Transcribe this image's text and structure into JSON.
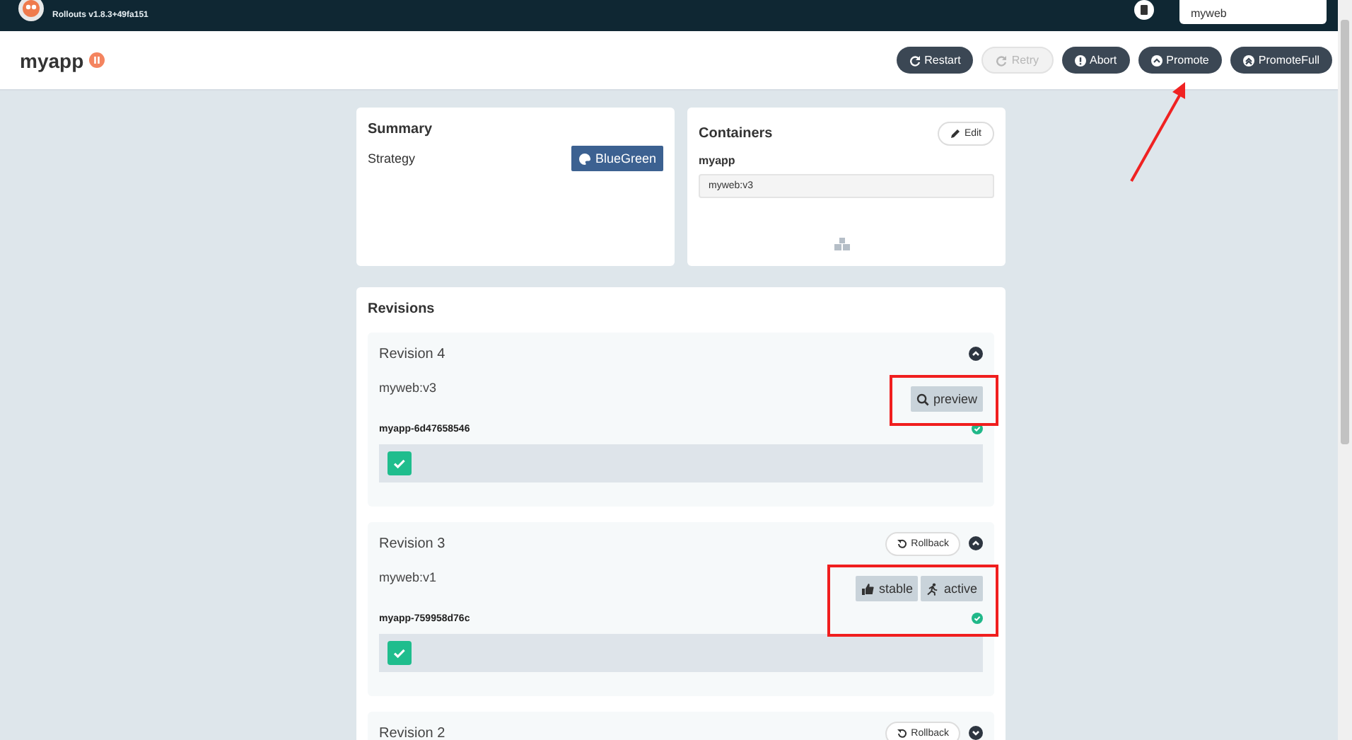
{
  "header": {
    "version": "Rollouts v1.8.3+49fa151",
    "search": {
      "value": "myweb"
    }
  },
  "title": {
    "name": "myapp",
    "paused": true
  },
  "actions": [
    {
      "label": "Restart",
      "kind": "restart",
      "disabled": false
    },
    {
      "label": "Retry",
      "kind": "retry",
      "disabled": true
    },
    {
      "label": "Abort",
      "kind": "abort",
      "disabled": false
    },
    {
      "label": "Promote",
      "kind": "promote",
      "disabled": false
    },
    {
      "label": "PromoteFull",
      "kind": "promotefull",
      "disabled": false
    }
  ],
  "summary": {
    "title": "Summary",
    "label": "Strategy",
    "strategy": "BlueGreen"
  },
  "containers": {
    "title": "Containers",
    "edit": "Edit",
    "name": "myapp",
    "image": "myweb:v3"
  },
  "revisions": {
    "title": "Revisions",
    "items": [
      {
        "title": "Revision 4",
        "expanded": true,
        "image": "myweb:v3",
        "badges": [
          {
            "kind": "preview",
            "label": "preview"
          }
        ],
        "replicaset": "myapp-6d47658546",
        "healthy": true,
        "pods": [
          {
            "ok": true
          }
        ]
      },
      {
        "title": "Revision 3",
        "rollback": "Rollback",
        "expanded": true,
        "image": "myweb:v1",
        "badges": [
          {
            "kind": "stable",
            "label": "stable"
          },
          {
            "kind": "active",
            "label": "active"
          }
        ],
        "replicaset": "myapp-759958d76c",
        "healthy": true,
        "pods": [
          {
            "ok": true
          }
        ]
      },
      {
        "title": "Revision 2",
        "rollback": "Rollback",
        "expanded": false
      }
    ]
  }
}
